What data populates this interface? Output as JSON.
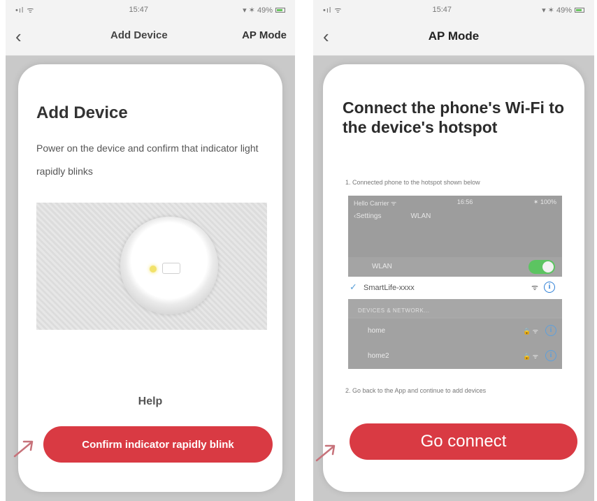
{
  "left_screen": {
    "statusbar": {
      "signal": "•ıl ᯤ",
      "time": "15:47",
      "battery": "▾ ✶ 49%"
    },
    "navbar": {
      "back": "‹",
      "title": "Add Device",
      "action": "AP Mode"
    },
    "title": "Add Device",
    "description": "Power on the device and confirm that indicator light rapidly blinks",
    "help_label": "Help",
    "confirm_button_label": "Confirm indicator rapidly blink"
  },
  "right_screen": {
    "statusbar": {
      "signal": "•ıl ᯤ",
      "time": "15:47",
      "battery": "▾ ✶ 49%"
    },
    "navbar": {
      "back": "‹",
      "title": "AP Mode"
    },
    "title": "Connect the phone's Wi-Fi to the device's hotspot",
    "step1": "1. Connected phone to the hotspot shown below",
    "wifi_settings": {
      "status_left": "Hello Carrier ᯤ",
      "status_center": "16:56",
      "status_right": "✶ 100%",
      "nav_back": "‹Settings",
      "nav_title": "WLAN",
      "wlan_label": "WLAN",
      "connected_check": "✓",
      "connected_network": "SmartLife-xxxx",
      "section_header": "DEVICES & NETWORK...",
      "networks": [
        {
          "name": "home",
          "signal": "🔒 ᯤ"
        },
        {
          "name": "home2",
          "signal": "🔒 ᯤ"
        }
      ],
      "info_glyph": "i",
      "wifi_glyph": "ᯤ"
    },
    "step2": "2. Go back to the App and continue to add devices",
    "go_button_label": "Go connect"
  },
  "colors": {
    "primary_button": "#d93a43",
    "frame_gray": "#c9c9c9",
    "toggle_green": "#5cc461",
    "info_blue": "#2d7fd6"
  },
  "icons": [
    "back-chevron-icon",
    "signal-icon",
    "battery-icon",
    "pointer-arrow-icon",
    "wifi-icon",
    "info-icon",
    "lock-icon",
    "checkmark-icon"
  ]
}
